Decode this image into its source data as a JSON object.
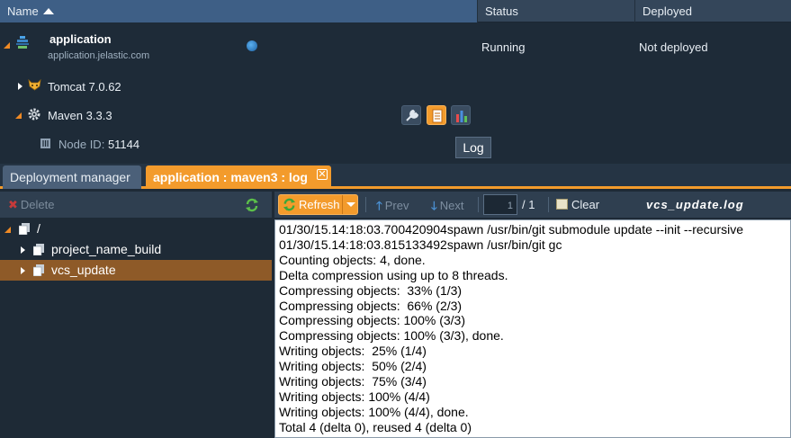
{
  "grid": {
    "columns": {
      "name": "Name",
      "status": "Status",
      "deployed": "Deployed"
    },
    "application": {
      "title": "application",
      "domain": "application.jelastic.com",
      "status": "Running",
      "deployed": "Not deployed"
    },
    "tomcat": {
      "label": "Tomcat 7.0.62"
    },
    "maven": {
      "label": "Maven 3.3.3"
    },
    "node": {
      "id_label": "Node ID:",
      "id_value": "51144"
    },
    "tooltip": "Log"
  },
  "tabs": [
    {
      "label": "Deployment manager"
    },
    {
      "label": "application : maven3 : log"
    }
  ],
  "left": {
    "delete_label": "Delete",
    "tree": [
      {
        "label": "/"
      },
      {
        "label": "project_name_build"
      },
      {
        "label": "vcs_update"
      }
    ]
  },
  "toolbar": {
    "refresh_label": "Refresh",
    "prev_label": "Prev",
    "next_label": "Next",
    "page_value": "1",
    "page_total": "/ 1",
    "clear_label": "Clear",
    "log_name": "vcs_update.log"
  },
  "log_lines": [
    "01/30/15.14:18:03.700420904spawn /usr/bin/git submodule update --init --recursive",
    "01/30/15.14:18:03.815133492spawn /usr/bin/git gc",
    "Counting objects: 4, done.",
    "Delta compression using up to 8 threads.",
    "Compressing objects:  33% (1/3)",
    "Compressing objects:  66% (2/3)",
    "Compressing objects: 100% (3/3)",
    "Compressing objects: 100% (3/3), done.",
    "Writing objects:  25% (1/4)",
    "Writing objects:  50% (2/4)",
    "Writing objects:  75% (3/4)",
    "Writing objects: 100% (4/4)",
    "Writing objects: 100% (4/4), done.",
    "Total 4 (delta 0), reused 4 (delta 0)"
  ],
  "colors": {
    "accent": "#f39b2c",
    "header_bg": "#34465a",
    "selected_row": "#8e5a28"
  }
}
